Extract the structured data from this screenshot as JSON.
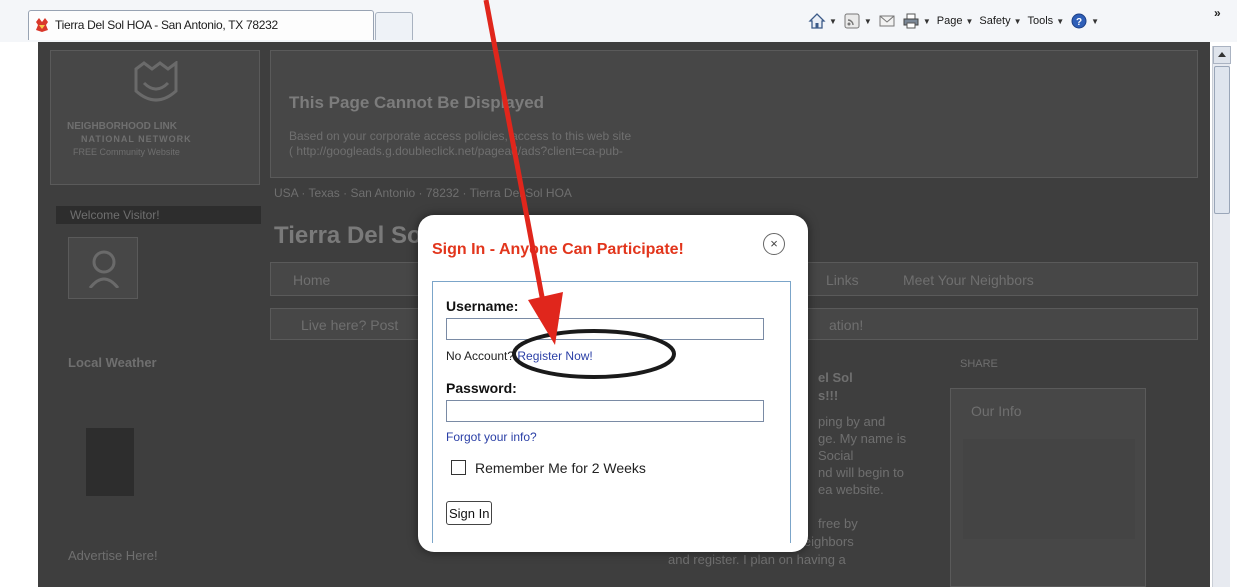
{
  "browser": {
    "tab_title": "Tierra Del Sol HOA - San Antonio, TX 78232",
    "commands": {
      "page": "Page",
      "safety": "Safety",
      "tools": "Tools"
    },
    "more": "»"
  },
  "background": {
    "logo_line1": "NEIGHBORHOOD LINK",
    "logo_line2": "NATIONAL NETWORK",
    "logo_line3": "FREE Community Website",
    "error_title": "This Page Cannot Be Displayed",
    "error_body1": "Based on your corporate access policies, access to this web site",
    "error_body2": "( http://googleads.g.doubleclick.net/pagead/ads?client=ca-pub-",
    "breadcrumb": "USA  ·  Texas  ·  San Antonio  ·  78232  ·  Tierra Del Sol HOA",
    "welcome": "Welcome Visitor!",
    "site_title": "Tierra Del Sol",
    "nav_home": "Home",
    "nav_links": "Links",
    "nav_meet": "Meet Your Neighbors",
    "live_here": "Live here? Post",
    "live_here_end": "ation!",
    "local_weather": "Local Weather",
    "advertise": "Advertise Here!",
    "our_info": "Our Info",
    "share": "SHARE",
    "story_1": "el Sol",
    "story_2": "s!!!",
    "story_3": "ping by and",
    "story_4": "ge. My name is",
    "story_5": "Social",
    "story_6": "nd will begin to",
    "story_7": "ea website.",
    "story_8": "free by",
    "story_9": "clicking on Meet Your Neighbors",
    "story_10": "and register. I plan on having a"
  },
  "modal": {
    "title": "Sign In - Anyone Can Participate!",
    "close": "×",
    "username_label": "Username:",
    "username_value": "",
    "no_account": "No Account? ",
    "register": "Register Now!",
    "password_label": "Password:",
    "password_value": "",
    "forgot": "Forgot your info?",
    "remember": "Remember Me for 2 Weeks",
    "signin": "Sign In"
  },
  "annotation": {
    "arrow_color": "#e0261c",
    "circle_color": "#1a1a1a"
  }
}
